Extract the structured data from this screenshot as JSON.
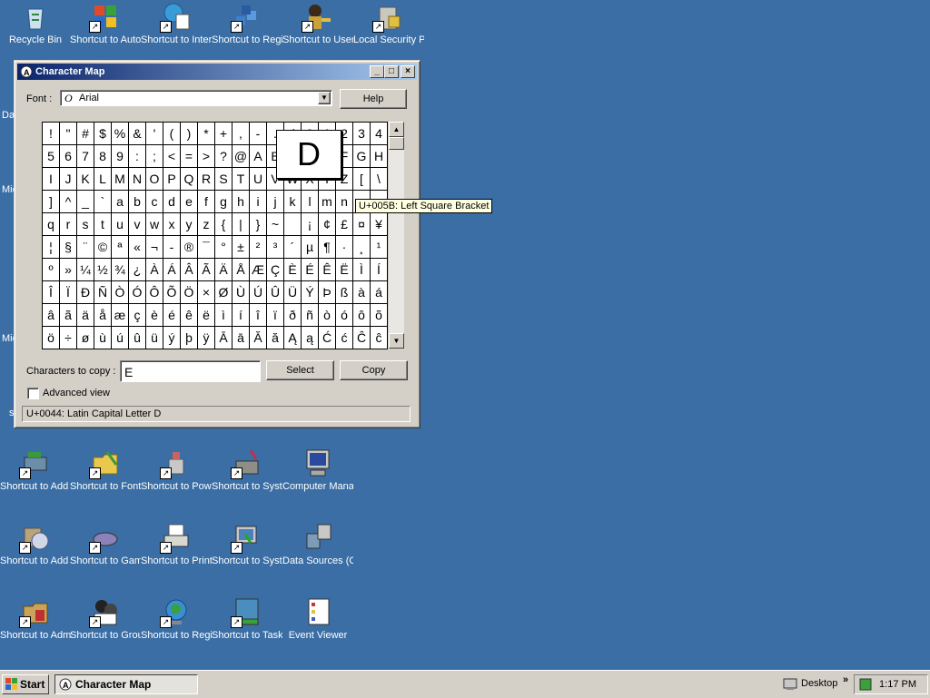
{
  "desktop": {
    "icons": [
      {
        "label": "Recycle Bin",
        "color": "#8fb7d9"
      },
      {
        "label": "Shortcut to Automat...",
        "color": "#d7452c"
      },
      {
        "label": "Shortcut to Internet...",
        "color": "#3a9bd8"
      },
      {
        "label": "Shortcut to Registry Editor",
        "color": "#3f7fcc"
      },
      {
        "label": "Shortcut to User Accou...",
        "color": "#c9a23a"
      },
      {
        "label": "Local Security Policy",
        "color": "#9a9a8c"
      },
      {
        "label": "Shortcut to Add Hardware",
        "color": "#6b8fa8"
      },
      {
        "label": "Shortcut to Fonts",
        "color": "#e8c94e"
      },
      {
        "label": "Shortcut to Power Options",
        "color": "#c96262"
      },
      {
        "label": "Shortcut to System Co...",
        "color": "#8e8e86"
      },
      {
        "label": "Computer Management",
        "color": "#4a74b4"
      },
      {
        "label": "Shortcut to Add or Remo...",
        "color": "#b7a47a"
      },
      {
        "label": "Shortcut to Game C...",
        "color": "#8a82b8"
      },
      {
        "label": "Shortcut to Printers a...",
        "color": "#d8d8d0"
      },
      {
        "label": "Shortcut to System",
        "color": "#4c7fc0"
      },
      {
        "label": "Data Sources (ODBC)",
        "color": "#7c9cb8"
      },
      {
        "label": "Shortcut to Administrati...",
        "color": "#c8a45a"
      },
      {
        "label": "Shortcut to Group Policy",
        "color": "#4a4a4a"
      },
      {
        "label": "Shortcut to Regional a...",
        "color": "#3a8fd0"
      },
      {
        "label": "Shortcut to Taskbar a...",
        "color": "#4a8ec0"
      },
      {
        "label": "Event Viewer",
        "color": "#d7c060"
      }
    ],
    "edge_fragments": [
      "Da",
      "Mic",
      "Mic",
      "s"
    ]
  },
  "window": {
    "title": "Character Map",
    "font_label": "Font :",
    "font_value": "Arial",
    "help_label": "Help",
    "chars_to_copy_label": "Characters to copy :",
    "chars_to_copy_value": "E",
    "select_label": "Select",
    "copy_label": "Copy",
    "advanced_view_label": "Advanced view",
    "status_text": "U+0044: Latin Capital Letter D",
    "magnified_char": "D",
    "tooltip": "U+005B: Left Square Bracket"
  },
  "grid_rows": [
    [
      "!",
      "\"",
      "#",
      "$",
      "%",
      "&",
      "'",
      "(",
      ")",
      "*",
      "+",
      ",",
      "-",
      ".",
      "/",
      "0",
      "1",
      "2",
      "3",
      "4"
    ],
    [
      "5",
      "6",
      "7",
      "8",
      "9",
      ":",
      ";",
      "<",
      "=",
      ">",
      "?",
      "@",
      "A",
      "B",
      "C",
      "D",
      "E",
      "F",
      "G",
      "H"
    ],
    [
      "I",
      "J",
      "K",
      "L",
      "M",
      "N",
      "O",
      "P",
      "Q",
      "R",
      "S",
      "T",
      "U",
      "V",
      "W",
      "X",
      "Y",
      "Z",
      "[",
      "\\"
    ],
    [
      "]",
      "^",
      "_",
      "`",
      "a",
      "b",
      "c",
      "d",
      "e",
      "f",
      "g",
      "h",
      "i",
      "j",
      "k",
      "l",
      "m",
      "n",
      "o",
      "p"
    ],
    [
      "q",
      "r",
      "s",
      "t",
      "u",
      "v",
      "w",
      "x",
      "y",
      "z",
      "{",
      "|",
      "}",
      "~",
      " ",
      "¡",
      "¢",
      "£",
      "¤",
      "¥"
    ],
    [
      "¦",
      "§",
      "¨",
      "©",
      "ª",
      "«",
      "¬",
      "-",
      "®",
      "¯",
      "°",
      "±",
      "²",
      "³",
      "´",
      "µ",
      "¶",
      "·",
      "¸",
      "¹"
    ],
    [
      "º",
      "»",
      "¼",
      "½",
      "¾",
      "¿",
      "À",
      "Á",
      "Â",
      "Ã",
      "Ä",
      "Å",
      "Æ",
      "Ç",
      "È",
      "É",
      "Ê",
      "Ë",
      "Ì",
      "Í"
    ],
    [
      "Î",
      "Ï",
      "Ð",
      "Ñ",
      "Ò",
      "Ó",
      "Ô",
      "Õ",
      "Ö",
      "×",
      "Ø",
      "Ù",
      "Ú",
      "Û",
      "Ü",
      "Ý",
      "Þ",
      "ß",
      "à",
      "á"
    ],
    [
      "â",
      "ã",
      "ä",
      "å",
      "æ",
      "ç",
      "è",
      "é",
      "ê",
      "ë",
      "ì",
      "í",
      "î",
      "ï",
      "ð",
      "ñ",
      "ò",
      "ó",
      "ô",
      "õ"
    ],
    [
      "ö",
      "÷",
      "ø",
      "ù",
      "ú",
      "û",
      "ü",
      "ý",
      "þ",
      "ÿ",
      "Ā",
      "ā",
      "Ă",
      "ă",
      "Ą",
      "ą",
      "Ć",
      "ć",
      "Ĉ",
      "ĉ"
    ]
  ],
  "taskbar": {
    "start_label": "Start",
    "task_label": "Character Map",
    "desktop_label": "Desktop",
    "clock": "1:17 PM"
  }
}
